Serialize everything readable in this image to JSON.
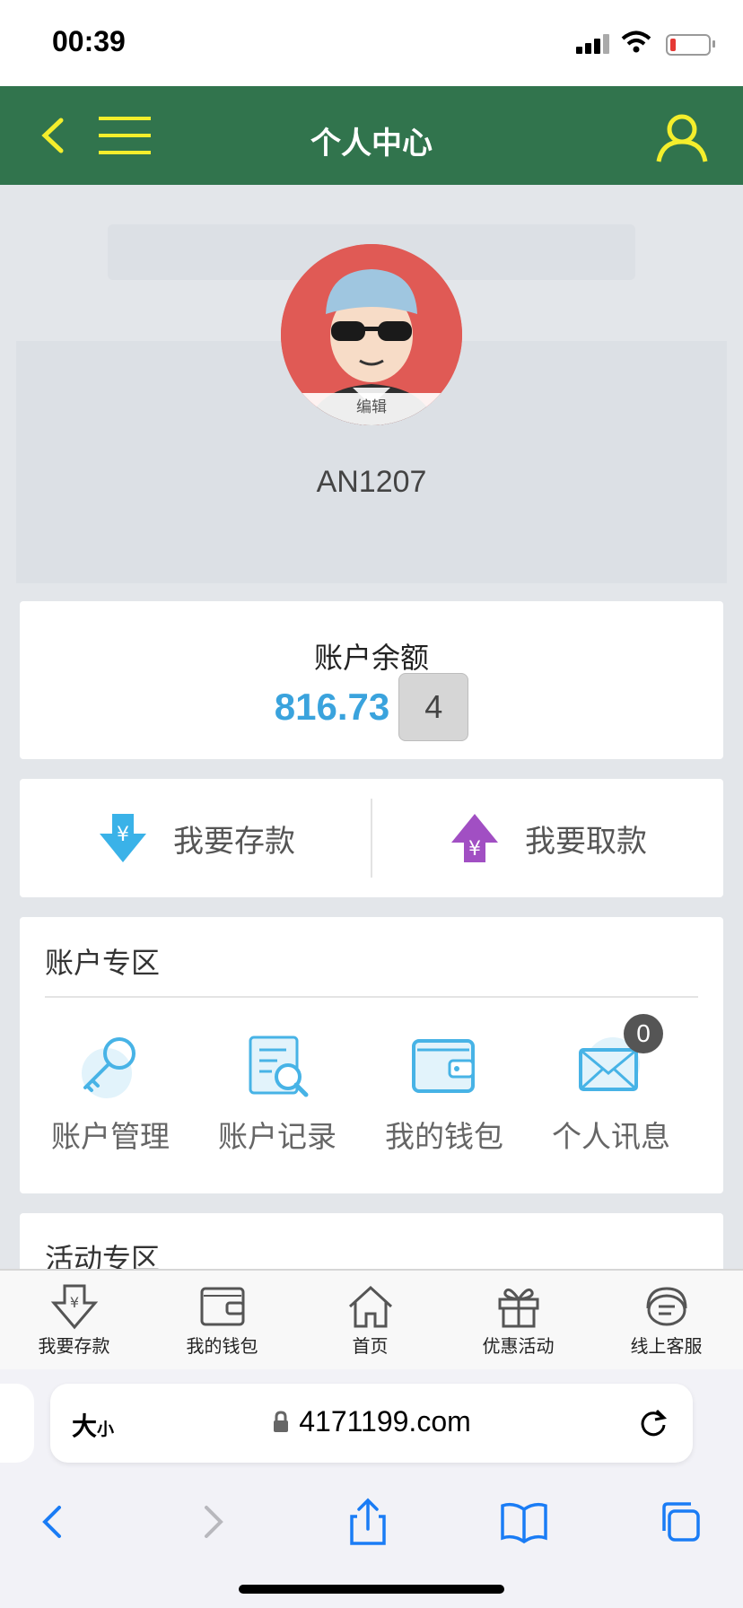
{
  "status_bar": {
    "time": "00:39"
  },
  "header": {
    "title": "个人中心"
  },
  "profile": {
    "avatar_edit_label": "编辑",
    "username": "AN1207"
  },
  "balance": {
    "label": "账户余额",
    "amount": "816.73",
    "refresh_count": "4"
  },
  "actions": {
    "deposit": "我要存款",
    "withdraw": "我要取款"
  },
  "account_zone": {
    "title": "账户专区",
    "items": [
      {
        "label": "账户管理",
        "icon": "key-icon"
      },
      {
        "label": "账户记录",
        "icon": "record-search-icon"
      },
      {
        "label": "我的钱包",
        "icon": "wallet-icon"
      },
      {
        "label": "个人讯息",
        "icon": "mail-icon",
        "badge": "0"
      }
    ]
  },
  "activity_zone": {
    "title": "活动专区"
  },
  "tabbar": {
    "items": [
      {
        "label": "我要存款",
        "icon": "deposit-icon"
      },
      {
        "label": "我的钱包",
        "icon": "wallet-icon"
      },
      {
        "label": "首页",
        "icon": "home-icon"
      },
      {
        "label": "优惠活动",
        "icon": "gift-icon"
      },
      {
        "label": "线上客服",
        "icon": "support-icon"
      }
    ]
  },
  "browser": {
    "size_label": "大",
    "size_label_small": "小",
    "url": "4171199.com"
  },
  "colors": {
    "header_green": "#31744d",
    "accent_yellow": "#f4ee2c",
    "amount_blue": "#3aa3dd"
  }
}
